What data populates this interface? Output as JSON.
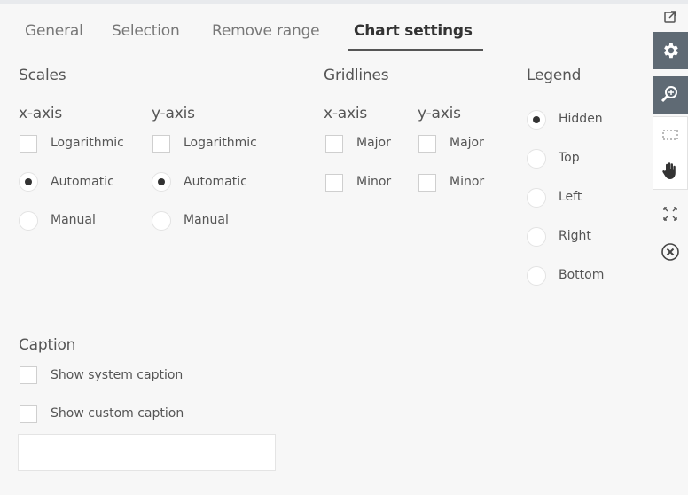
{
  "tabs": [
    {
      "label": "General"
    },
    {
      "label": "Selection"
    },
    {
      "label": "Remove range"
    },
    {
      "label": "Chart settings"
    }
  ],
  "scales": {
    "title": "Scales",
    "x_axis": {
      "title": "x-axis",
      "logarithmic": "Logarithmic",
      "automatic": "Automatic",
      "manual": "Manual",
      "selected": "Automatic"
    },
    "y_axis": {
      "title": "y-axis",
      "logarithmic": "Logarithmic",
      "automatic": "Automatic",
      "manual": "Manual",
      "selected": "Automatic"
    }
  },
  "gridlines": {
    "title": "Gridlines",
    "x_axis": {
      "title": "x-axis",
      "major": "Major",
      "minor": "Minor"
    },
    "y_axis": {
      "title": "y-axis",
      "major": "Major",
      "minor": "Minor"
    }
  },
  "legend": {
    "title": "Legend",
    "options": [
      "Hidden",
      "Top",
      "Left",
      "Right",
      "Bottom"
    ],
    "selected": "Hidden"
  },
  "caption": {
    "title": "Caption",
    "show_system": "Show system caption",
    "show_custom": "Show custom caption",
    "custom_value": ""
  },
  "toolbar": {
    "icons": [
      "expand-window-icon",
      "gear-icon",
      "zoom-icon",
      "selection-box-icon",
      "pan-hand-icon",
      "fit-arrows-icon",
      "close-circle-icon"
    ],
    "dark_color": "#5f6a74"
  }
}
